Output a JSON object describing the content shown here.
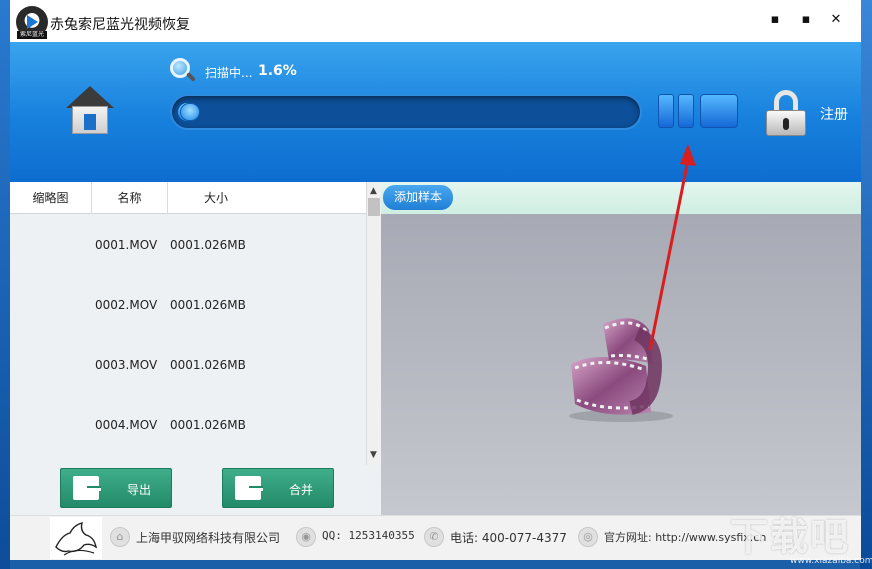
{
  "app": {
    "title": "赤兔索尼蓝光视频恢复",
    "logo_text": "索尼蓝光"
  },
  "window_controls": {
    "minimize": "▪",
    "maximize": "▪",
    "close": "✕"
  },
  "scan": {
    "status": "扫描中...",
    "percent": "1.6%",
    "progress": 0.016
  },
  "header": {
    "register_label": "注册"
  },
  "table": {
    "columns": [
      "缩略图",
      "名称",
      "大小"
    ],
    "rows": [
      {
        "name": "0001.MOV",
        "size": "0001.026MB"
      },
      {
        "name": "0002.MOV",
        "size": "0001.026MB"
      },
      {
        "name": "0003.MOV",
        "size": "0001.026MB"
      },
      {
        "name": "0004.MOV",
        "size": "0001.026MB"
      }
    ]
  },
  "buttons": {
    "export": "导出",
    "merge": "合并",
    "add_sample": "添加样本"
  },
  "footer": {
    "company": "上海甲驭网络科技有限公司",
    "qq": "QQ: 1253140355",
    "phone": "电话: 400-077-4377",
    "website": "官方网址: http://www.sysfix.cn"
  },
  "watermark": {
    "text": "下载吧",
    "sub": "www.xiazaiba.com"
  },
  "colors": {
    "header_blue": "#1780dd",
    "button_green": "#238a68",
    "annotation_red": "#d81e1e"
  }
}
